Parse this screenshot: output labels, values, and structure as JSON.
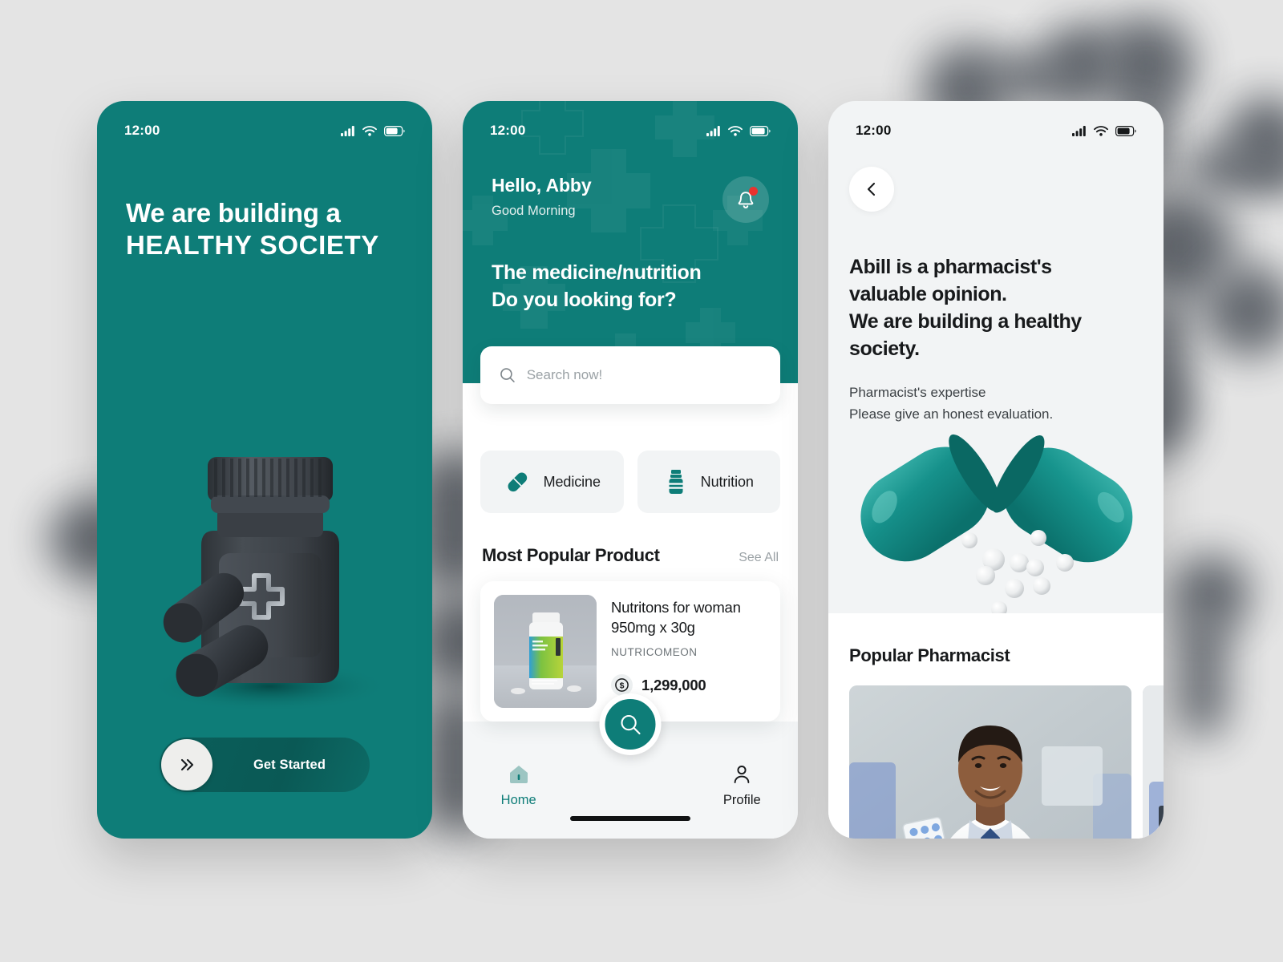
{
  "theme": {
    "teal": "#0E7D78",
    "teal_dark": "#0A5955",
    "page_bg": "#E4E4E4",
    "accent_red": "#E8332F",
    "text_dark": "#17191B",
    "text_muted": "#9AA1A5"
  },
  "screens": [
    {
      "id": "onboarding",
      "status_bar": {
        "time": "12:00",
        "signal": "cellular-signal-icon",
        "wifi": "wifi-icon",
        "battery": "battery-icon"
      },
      "headline_line1": "We are building a",
      "headline_line2": "HEALTHY SOCIETY",
      "illustration": "pill-bottle-3d-illustration",
      "cta": {
        "label": "Get Started",
        "knob_icon": "double-chevron-right-icon"
      }
    },
    {
      "id": "home",
      "status_bar": {
        "time": "12:00",
        "signal": "cellular-signal-icon",
        "wifi": "wifi-icon",
        "battery": "battery-icon"
      },
      "greeting": "Hello, Abby",
      "greeting_sub": "Good Morning",
      "notification": {
        "icon": "bell-icon",
        "has_unread": true
      },
      "question_line1": "The medicine/nutrition",
      "question_line2": "Do you looking for?",
      "search": {
        "placeholder": "Search now!",
        "value": "",
        "icon": "search-icon"
      },
      "categories": [
        {
          "label": "Medicine",
          "icon": "capsule-icon"
        },
        {
          "label": "Nutrition",
          "icon": "supplement-bottle-icon"
        }
      ],
      "section": {
        "title": "Most Popular Product",
        "see_all": "See All"
      },
      "product": {
        "name_line1": "Nutritons for woman",
        "name_line2": "950mg x 30g",
        "brand": "NUTRICOMEON",
        "price": "1,299,000",
        "price_icon": "dollar-coin-icon",
        "thumb": "supplement-bottle-photo"
      },
      "fab": {
        "icon": "search-icon"
      },
      "tabs": [
        {
          "label": "Home",
          "icon": "home-icon",
          "active": true
        },
        {
          "label": "Profile",
          "icon": "person-icon",
          "active": false
        }
      ]
    },
    {
      "id": "pharmacist",
      "status_bar": {
        "time": "12:00",
        "signal": "cellular-signal-icon",
        "wifi": "wifi-icon",
        "battery": "battery-icon"
      },
      "back": {
        "icon": "chevron-left-icon"
      },
      "title_line1": "Abill is a pharmacist's",
      "title_line2": "valuable opinion.",
      "title_line3": "We are building a healthy",
      "title_line4": "society.",
      "sub_line1": "Pharmacist's expertise",
      "sub_line2": "Please give an honest evaluation.",
      "illustration": "open-capsule-with-beads-illustration",
      "section_title": "Popular Pharmacist",
      "cards": [
        {
          "image": "pharmacist-photo-1"
        },
        {
          "image": "pharmacist-photo-2"
        }
      ]
    }
  ]
}
